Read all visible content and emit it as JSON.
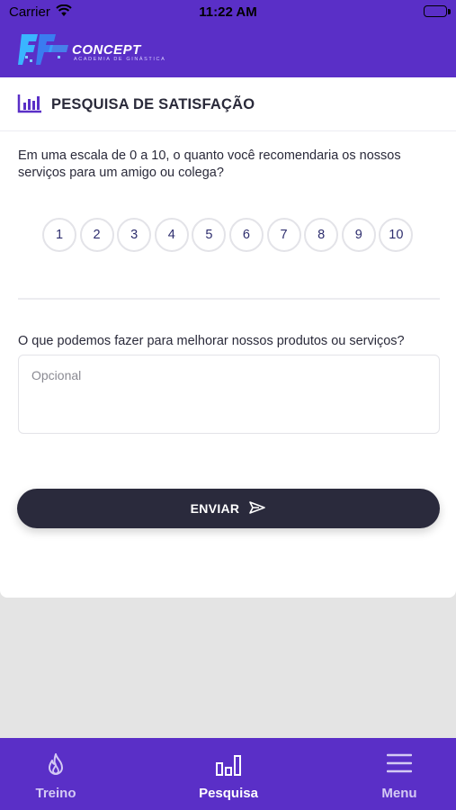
{
  "status_bar": {
    "carrier": "Carrier",
    "time": "11:22 AM"
  },
  "brand": {
    "name": "CONCEPT",
    "tagline": "ACADEMIA DE GINÁSTICA",
    "primary_color": "#5a2fc7",
    "accent_color": "#3ab5ff"
  },
  "survey": {
    "title": "PESQUISA DE SATISFAÇÃO",
    "title_icon": "bar-chart-icon",
    "question": "Em uma escala de 0 a 10, o quanto você recomendaria os nossos serviços para um amigo ou colega?",
    "scale": [
      "1",
      "2",
      "3",
      "4",
      "5",
      "6",
      "7",
      "8",
      "9",
      "10"
    ],
    "improve_question": "O que podemos fazer para melhorar nossos produtos ou serviços?",
    "improve_placeholder": "Opcional",
    "improve_value": "",
    "submit_label": "ENVIAR",
    "submit_icon": "send-icon"
  },
  "tabbar": {
    "items": [
      {
        "label": "Treino",
        "icon": "flame-icon",
        "active": false
      },
      {
        "label": "Pesquisa",
        "icon": "bar-chart-icon",
        "active": true
      },
      {
        "label": "Menu",
        "icon": "hamburger-icon",
        "active": false
      }
    ]
  }
}
